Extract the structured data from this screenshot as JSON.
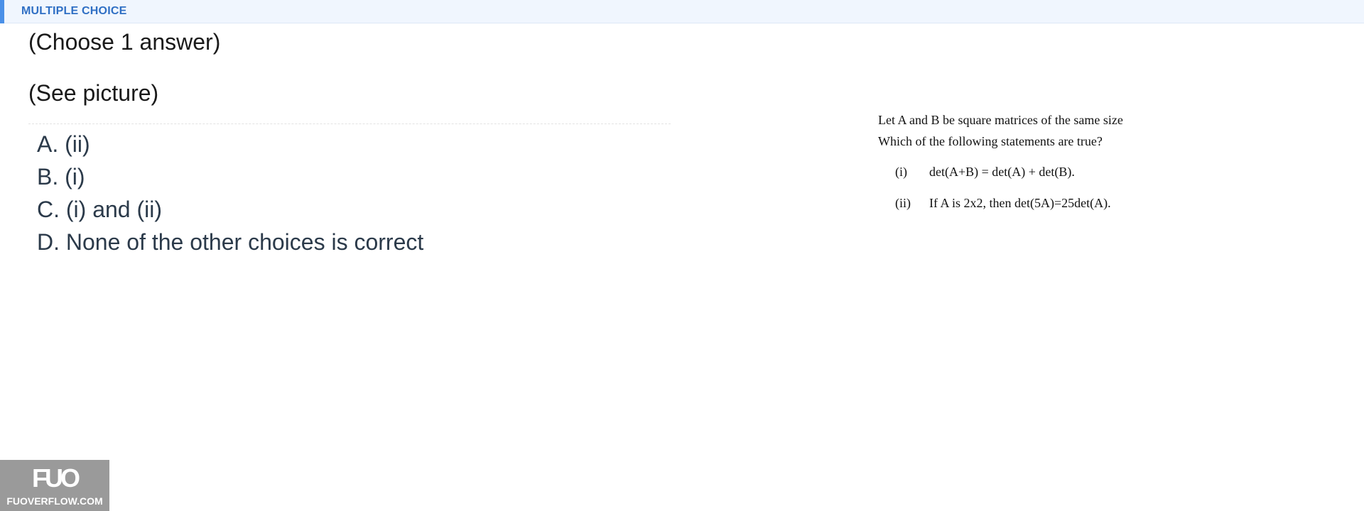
{
  "header": {
    "title": "MULTIPLE CHOICE",
    "accent_color": "#4a90e8"
  },
  "instructions": {
    "choose": "(Choose 1 answer)",
    "see": "(See picture)"
  },
  "choices": [
    {
      "label": "A. (ii)"
    },
    {
      "label": "B. (i)"
    },
    {
      "label": "C. (i) and (ii)"
    },
    {
      "label": "D. None of the other choices is correct"
    }
  ],
  "question_picture": {
    "line1": "Let A and B be square matrices of the same size",
    "line2": "Which of the following statements are true?",
    "statements": [
      {
        "num": "(i)",
        "text": "det(A+B) = det(A) + det(B)."
      },
      {
        "num": "(ii)",
        "text": "If A is 2x2, then det(5A)=25det(A)."
      }
    ]
  },
  "watermark": {
    "logo": "FUO",
    "site": "FUOVERFLOW.COM"
  }
}
